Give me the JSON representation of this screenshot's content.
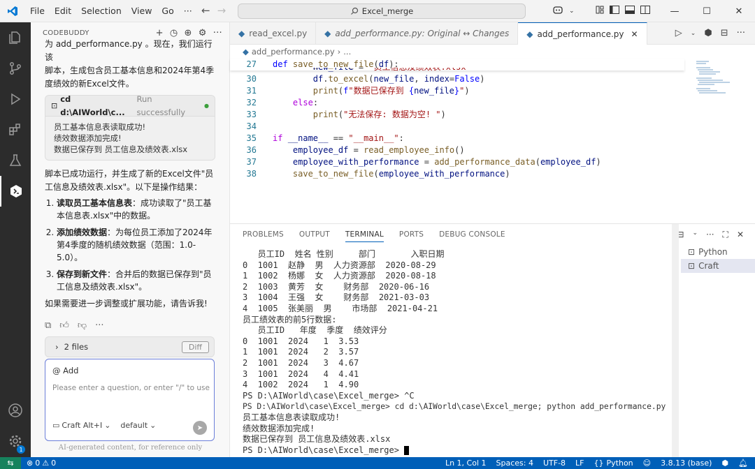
{
  "titlebar": {
    "menus": [
      "File",
      "Edit",
      "Selection",
      "View",
      "Go",
      "···"
    ],
    "search_text": "Excel_merge"
  },
  "sidebar": {
    "panel_title": "CODEBUDDY",
    "intro_lines": [
      "为 add_performance.py 。现在，我们运行该",
      "脚本，生成包含员工基本信息和2024年第4季",
      "度绩效的新Excel文件。"
    ],
    "command": {
      "label": "cd d:\\AIWorld\\c...",
      "status": "Run successfully",
      "output": [
        "员工基本信息表读取成功!",
        "绩效数据添加完成!",
        "数据已保存到 员工信息及绩效表.xlsx"
      ]
    },
    "summary": "脚本已成功运行，并生成了新的Excel文件\"员工信息及绩效表.xlsx\"。以下是操作结果：",
    "steps": [
      {
        "title": "读取员工基本信息表",
        "text": "：成功读取了\"员工基本信息表.xlsx\"中的数据。"
      },
      {
        "title": "添加绩效数据",
        "text": "：为每位员工添加了2024年第4季度的随机绩效数据（范围：1.0-5.0）。"
      },
      {
        "title": "保存到新文件",
        "text": "：合并后的数据已保存到\"员工信息及绩效表.xlsx\"。"
      }
    ],
    "closing": "如果需要进一步调整或扩展功能，请告诉我!",
    "files_label": "2 files",
    "diff_label": "Diff",
    "input_add": "@ Add",
    "input_placeholder": "Please enter a question, or enter \"/\" to use sho",
    "mode_label": "Craft Alt+I",
    "model_label": "default",
    "ai_note": "AI-generated content, for reference only"
  },
  "editor": {
    "tabs": [
      {
        "label": "read_excel.py"
      },
      {
        "label": "add_performance.py: Original ↔ Changes"
      },
      {
        "label": "add_performance.py"
      }
    ],
    "breadcrumb": [
      "add_performance.py",
      "..."
    ],
    "line_numbers": [
      "27",
      "30",
      "31",
      "32",
      "33",
      "34",
      "35",
      "36",
      "37",
      "38"
    ]
  },
  "panel": {
    "tabs": [
      "PROBLEMS",
      "OUTPUT",
      "TERMINAL",
      "PORTS",
      "DEBUG CONSOLE"
    ],
    "terminal_lines": [
      "   员工ID  姓名 性别     部门       入职日期",
      "0  1001  赵静  男  人力资源部  2020-08-29",
      "1  1002  杨娜  女  人力资源部  2020-08-18",
      "2  1003  黄芳  女    财务部  2020-06-16",
      "3  1004  王强  女    财务部  2021-03-03",
      "4  1005  张美丽  男    市场部  2021-04-21",
      "员工绩效表的前5行数据:",
      "   员工ID   年度  季度  绩效评分",
      "0  1001  2024   1  3.53",
      "1  1001  2024   2  3.57",
      "2  1001  2024   3  4.67",
      "3  1001  2024   4  4.41",
      "4  1002  2024   1  4.90",
      "PS D:\\AIWorld\\case\\Excel_merge> ^C",
      "PS D:\\AIWorld\\case\\Excel_merge> cd d:\\AIWorld\\case\\Excel_merge; python add_performance.py",
      "员工基本信息表读取成功!",
      "绩效数据添加完成!",
      "数据已保存到 员工信息及绩效表.xlsx",
      "PS D:\\AIWorld\\case\\Excel_merge> "
    ],
    "terminals": [
      "Python",
      "Craft"
    ]
  },
  "statusbar": {
    "errors": "0",
    "warnings": "0",
    "position": "Ln 1, Col 1",
    "spaces": "Spaces: 4",
    "encoding": "UTF-8",
    "eol": "LF",
    "language": "Python",
    "interpreter": "3.8.13 (base)"
  },
  "colors": {
    "accent": "#005fb8",
    "activity_bar": "#2c2c2c"
  }
}
